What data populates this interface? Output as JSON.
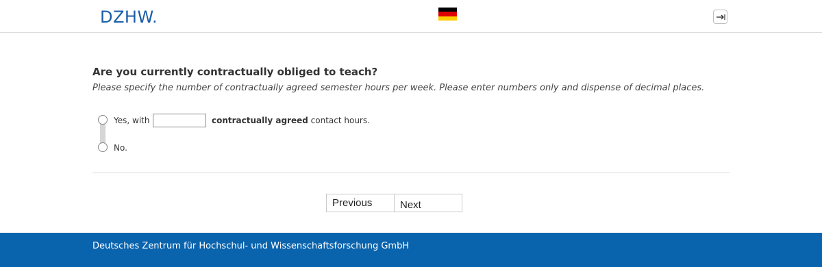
{
  "header": {
    "logo_text": "DZHW.",
    "language_flag": "german-flag-icon",
    "logout_icon": "logout-icon"
  },
  "question": {
    "title": "Are you currently contractually obliged to teach?",
    "hint": "Please specify the number of contractually agreed semester hours per week. Please enter numbers only and dispense of decimal places."
  },
  "options": {
    "yes_label": "Yes, with",
    "hours_value": "",
    "hours_placeholder": "",
    "contact_bold": "contractually agreed",
    "contact_rest": " contact hours.",
    "no_label": "No."
  },
  "navigation": {
    "previous_label": "Previous",
    "next_label": "Next"
  },
  "footer": {
    "text": "Deutsches Zentrum für Hochschul- und Wissenschaftsforschung GmbH"
  },
  "colors": {
    "brand_blue": "#1b5ea8",
    "footer_blue": "#0a63ad"
  }
}
